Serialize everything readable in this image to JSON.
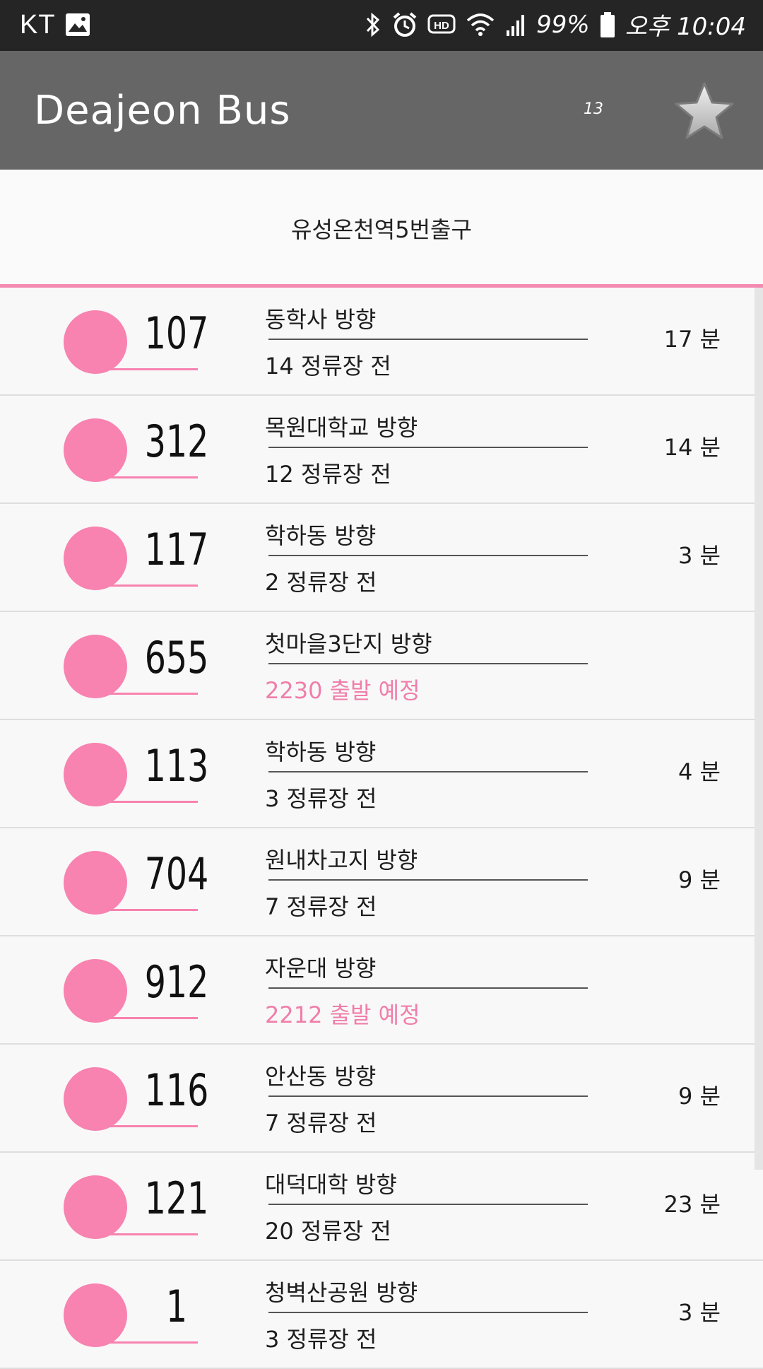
{
  "status_bar": {
    "carrier": "KT",
    "battery": "99%",
    "time": "오후 10:04"
  },
  "app_bar": {
    "title": "Deajeon Bus",
    "counter": "13"
  },
  "stop": {
    "name": "유성온천역5번출구"
  },
  "colors": {
    "accent": "#f882b0",
    "app_bar": "#666666",
    "status_bar": "#252525"
  },
  "buses": [
    {
      "number": "107",
      "direction": "동학사 방향",
      "stops": "14 정류장 전",
      "eta": "17 분",
      "scheduled": false
    },
    {
      "number": "312",
      "direction": "목원대학교 방향",
      "stops": "12 정류장 전",
      "eta": "14 분",
      "scheduled": false
    },
    {
      "number": "117",
      "direction": "학하동 방향",
      "stops": "2 정류장 전",
      "eta": "3 분",
      "scheduled": false
    },
    {
      "number": "655",
      "direction": "첫마을3단지 방향",
      "stops": "2230 출발 예정",
      "eta": "",
      "scheduled": true
    },
    {
      "number": "113",
      "direction": "학하동 방향",
      "stops": "3 정류장 전",
      "eta": "4 분",
      "scheduled": false
    },
    {
      "number": "704",
      "direction": "원내차고지 방향",
      "stops": "7 정류장 전",
      "eta": "9 분",
      "scheduled": false
    },
    {
      "number": "912",
      "direction": "자운대 방향",
      "stops": "2212 출발 예정",
      "eta": "",
      "scheduled": true
    },
    {
      "number": "116",
      "direction": "안산동 방향",
      "stops": "7 정류장 전",
      "eta": "9 분",
      "scheduled": false
    },
    {
      "number": "121",
      "direction": "대덕대학 방향",
      "stops": "20 정류장 전",
      "eta": "23 분",
      "scheduled": false
    },
    {
      "number": "1",
      "direction": "청벽산공원 방향",
      "stops": "3 정류장 전",
      "eta": "3 분",
      "scheduled": false
    }
  ]
}
